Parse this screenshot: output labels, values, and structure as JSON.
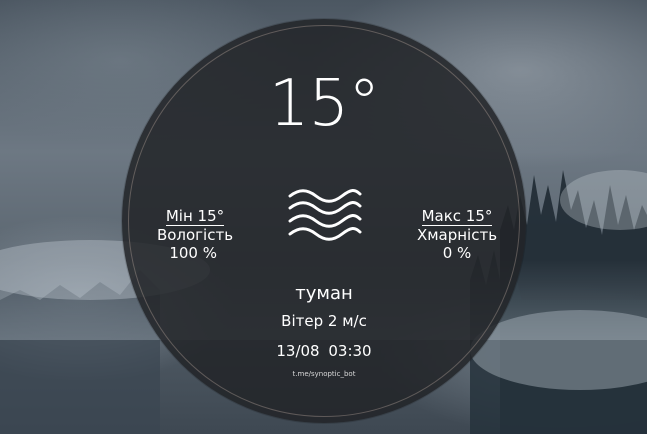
{
  "weather": {
    "temperature": "15°",
    "condition_icon": "fog-icon",
    "min_label": "Мін 15°",
    "humidity_label": "Вологість",
    "humidity_value": "100 %",
    "max_label": "Макс 15°",
    "cloudiness_label": "Хмарність",
    "cloudiness_value": "0 %",
    "description": "туман",
    "wind": "Вітер 2 м/с",
    "datetime": "13/08  03:30",
    "bot_link": "t.me/synoptic_bot"
  },
  "colors": {
    "circle": "#222428",
    "text": "#ffffff",
    "ring": "#c8b4aa"
  }
}
